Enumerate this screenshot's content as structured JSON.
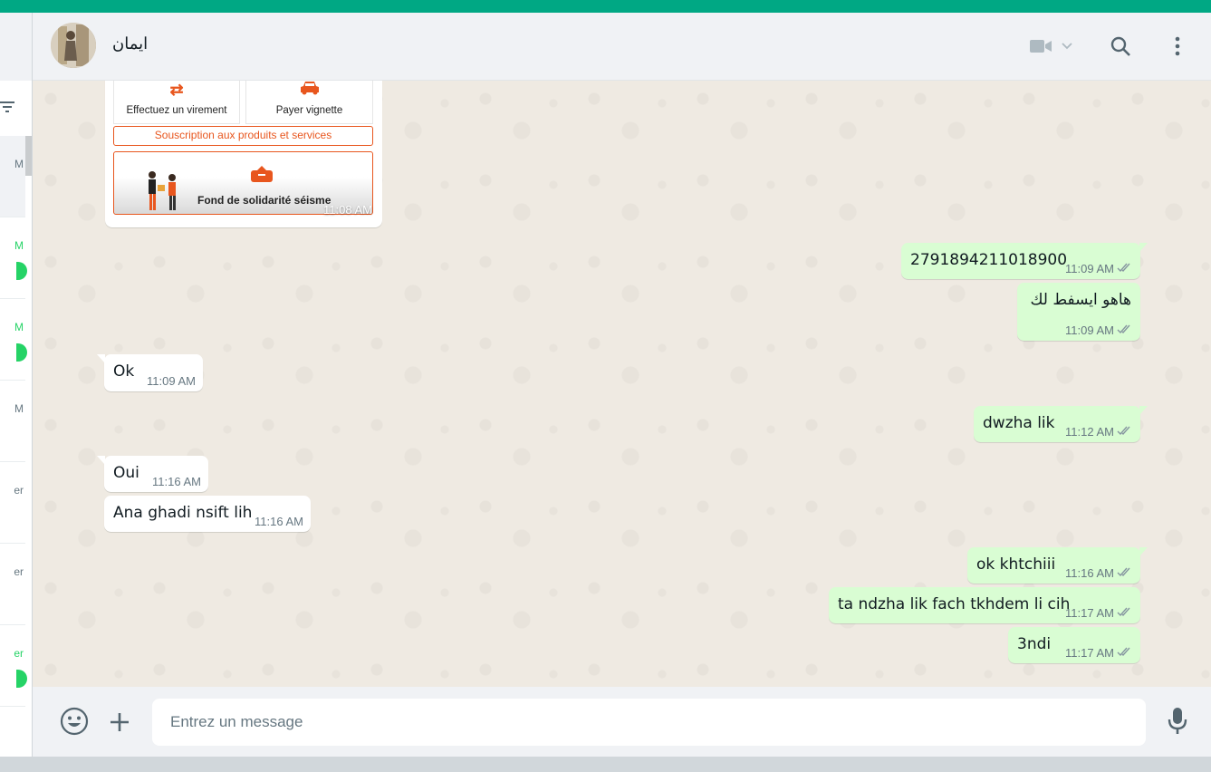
{
  "colors": {
    "accent": "#00a884",
    "outgoing_bubble": "#d9fdd3",
    "incoming_bubble": "#ffffff",
    "chat_background": "#efeae2",
    "panel": "#f0f2f5",
    "unread": "#25d366",
    "image_brand": "#e8561e"
  },
  "sidebar": {
    "filter_icon": "filter-icon",
    "rows": [
      {
        "time": "M",
        "unread": false,
        "active": true
      },
      {
        "time": "M",
        "unread": true
      },
      {
        "time": "M",
        "unread": true
      },
      {
        "time": "M",
        "unread": false
      },
      {
        "time": "er",
        "unread": false
      },
      {
        "time": "er",
        "unread": false
      },
      {
        "time": "er",
        "unread": true
      }
    ]
  },
  "header": {
    "contact_name": "ايمان",
    "icons": [
      "video-camera-icon",
      "chevron-down-icon",
      "search-icon",
      "menu-icon"
    ]
  },
  "image_message": {
    "tiles": [
      {
        "label": "Effectuez un virement",
        "icon": "⇄"
      },
      {
        "label": "Payer vignette",
        "icon": "🚗"
      }
    ],
    "subscribe_label": "Souscription aux produits et services",
    "fund_label": "Fond de solidarité séisme",
    "time": "11:08 AM"
  },
  "messages": [
    {
      "dir": "out",
      "text": "2791894211018900",
      "time": "11:09 AM",
      "ticks": "✓✓"
    },
    {
      "dir": "out",
      "text": "هاهو ايسفط لك",
      "time": "11:09 AM",
      "ticks": "✓✓"
    },
    {
      "dir": "in",
      "text": "Ok",
      "time": "11:09 AM"
    },
    {
      "dir": "out",
      "text": "dwzha lik",
      "time": "11:12 AM",
      "ticks": "✓✓"
    },
    {
      "dir": "in",
      "text": "Oui",
      "time": "11:16 AM"
    },
    {
      "dir": "in",
      "text": "Ana ghadi nsift lih",
      "time": "11:16 AM"
    },
    {
      "dir": "out",
      "text": "ok khtchiii",
      "time": "11:16 AM",
      "ticks": "✓✓"
    },
    {
      "dir": "out",
      "text": "ta ndzha lik fach tkhdem li cih",
      "time": "11:17 AM",
      "ticks": "✓✓"
    },
    {
      "dir": "out",
      "text": "3ndi",
      "time": "11:17 AM",
      "ticks": "✓✓"
    }
  ],
  "composer": {
    "placeholder": "Entrez un message",
    "value": "",
    "icons": [
      "emoji-icon",
      "plus-icon",
      "microphone-icon"
    ]
  }
}
